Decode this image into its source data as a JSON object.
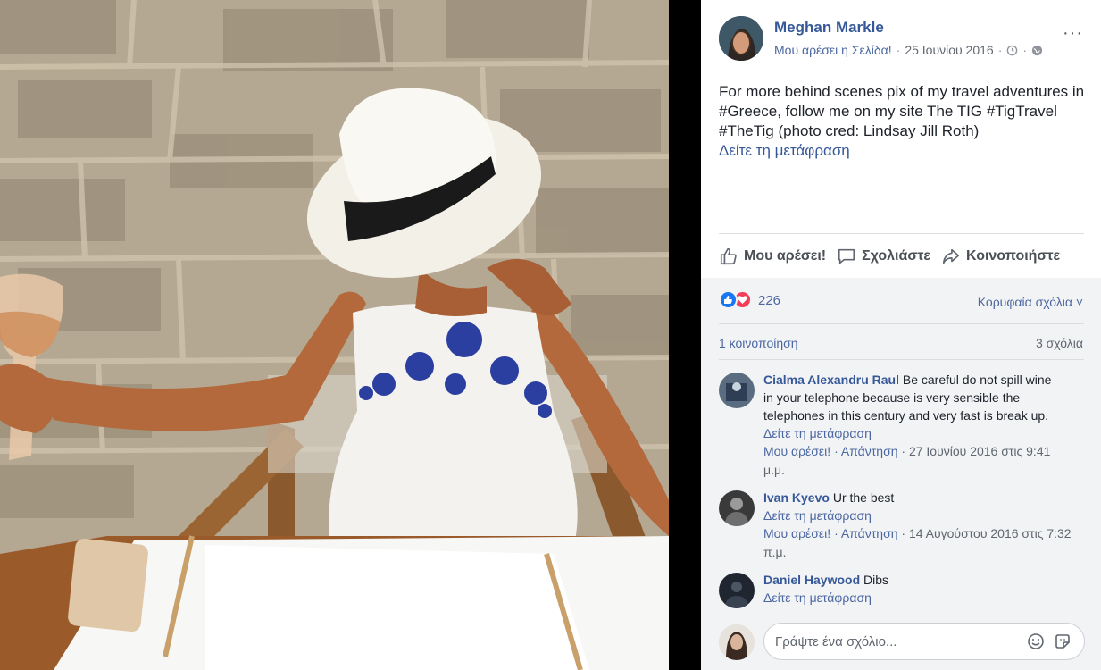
{
  "post": {
    "author": "Meghan Markle",
    "page_like": "Μου αρέσει η Σελίδα!",
    "separator": "·",
    "date": "25 Ιουνίου 2016",
    "more": "···",
    "text": "For more behind scenes pix of my travel adventures in #Greece, follow me on my site The TIG #TigTravel #TheTig (photo cred: Lindsay Jill Roth)",
    "see_translation": "Δείτε τη μετάφραση"
  },
  "actions": {
    "like": "Μου αρέσει!",
    "comment": "Σχολιάστε",
    "share": "Κοινοποιήστε"
  },
  "stats": {
    "reaction_count": "226",
    "top_comments": "Κορυφαία σχόλια ˅",
    "shares": "1 κοινοποίηση",
    "comments": "3 σχόλια"
  },
  "comments": [
    {
      "name": "Cialma Alexandru Raul",
      "text": "Be careful do not spill wine in your telephone because is very sensible the telephones in this century and very fast is break up.",
      "translate": "Δείτε τη μετάφραση",
      "like": "Μου αρέσει!",
      "reply": "Απάντηση",
      "date": "27 Ιουνίου 2016 στις 9:41 μ.μ."
    },
    {
      "name": "Ivan Kyevo",
      "text": "Ur the best",
      "translate": "Δείτε τη μετάφραση",
      "like": "Μου αρέσει!",
      "reply": "Απάντηση",
      "date": "14 Αυγούστου 2016 στις 7:32 π.μ."
    },
    {
      "name": "Daniel Haywood",
      "text": "Dibs",
      "translate": "Δείτε τη μετάφραση"
    }
  ],
  "composer": {
    "placeholder": "Γράψτε ένα σχόλιο..."
  },
  "colors": {
    "link": "#365899",
    "like_blue": "#1877f2",
    "love_red": "#f33e58"
  }
}
